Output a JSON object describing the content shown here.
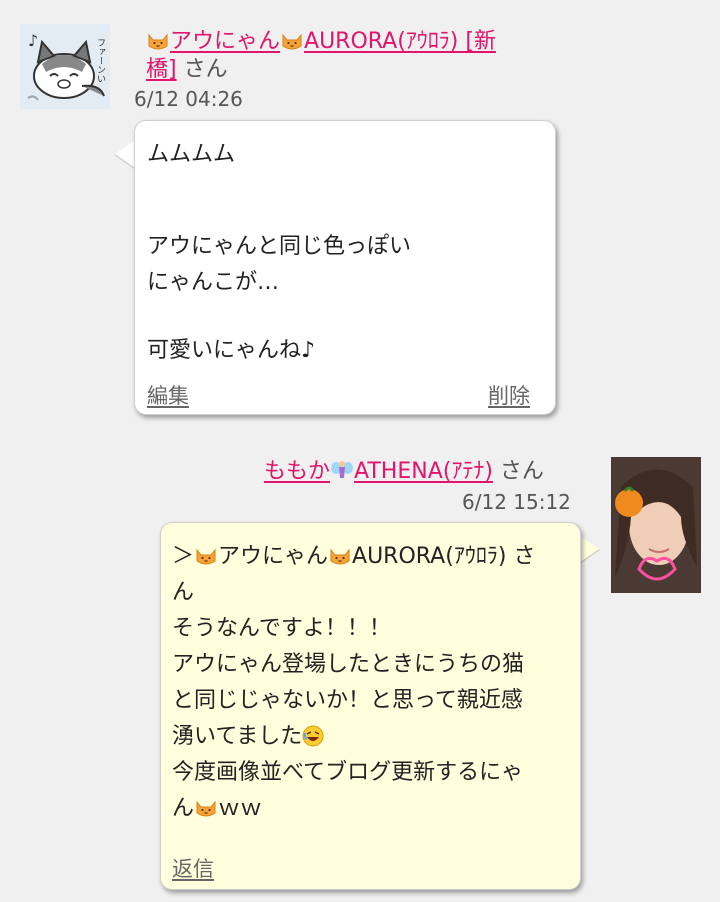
{
  "post1": {
    "author_prefix": "アウにゃん",
    "author_main": "AURORA(ｱｳﾛﾗ) [新",
    "author_line2": "橋]",
    "honorific": "さん",
    "timestamp": "6/12 04:26",
    "avatar_caption": "ファーンい",
    "lines": [
      "ムムムム",
      "",
      "アウにゃんと同じ色っぽい",
      "にゃんこが…",
      "",
      "可愛いにゃんね♪"
    ],
    "edit_label": "編集",
    "delete_label": "削除"
  },
  "post2": {
    "author_prefix": "ももか",
    "author_main": "ATHENA(ｱﾃﾅ)",
    "honorific": "さん",
    "timestamp": "6/12 15:12",
    "quote_prefix": "＞",
    "quote_name_1": "アウにゃん",
    "quote_name_2": "AURORA(ｱｳﾛﾗ) さ",
    "quote_tail": "ん",
    "line3": "そうなんですよ！！！",
    "line4": "アウにゃん登場したときにうちの猫",
    "line5": "と同じじゃないか！と思って親近感",
    "line6": "湧いてました",
    "line7": "今度画像並べてブログ更新するにゃ",
    "line8_start": "ん",
    "line8_end": "ｗｗ",
    "reply_label": "返信"
  },
  "colors": {
    "link": "#e0156b",
    "bubble_left": "#ffffff",
    "bubble_right": "#ffffdd",
    "background": "#f0f0f0"
  }
}
